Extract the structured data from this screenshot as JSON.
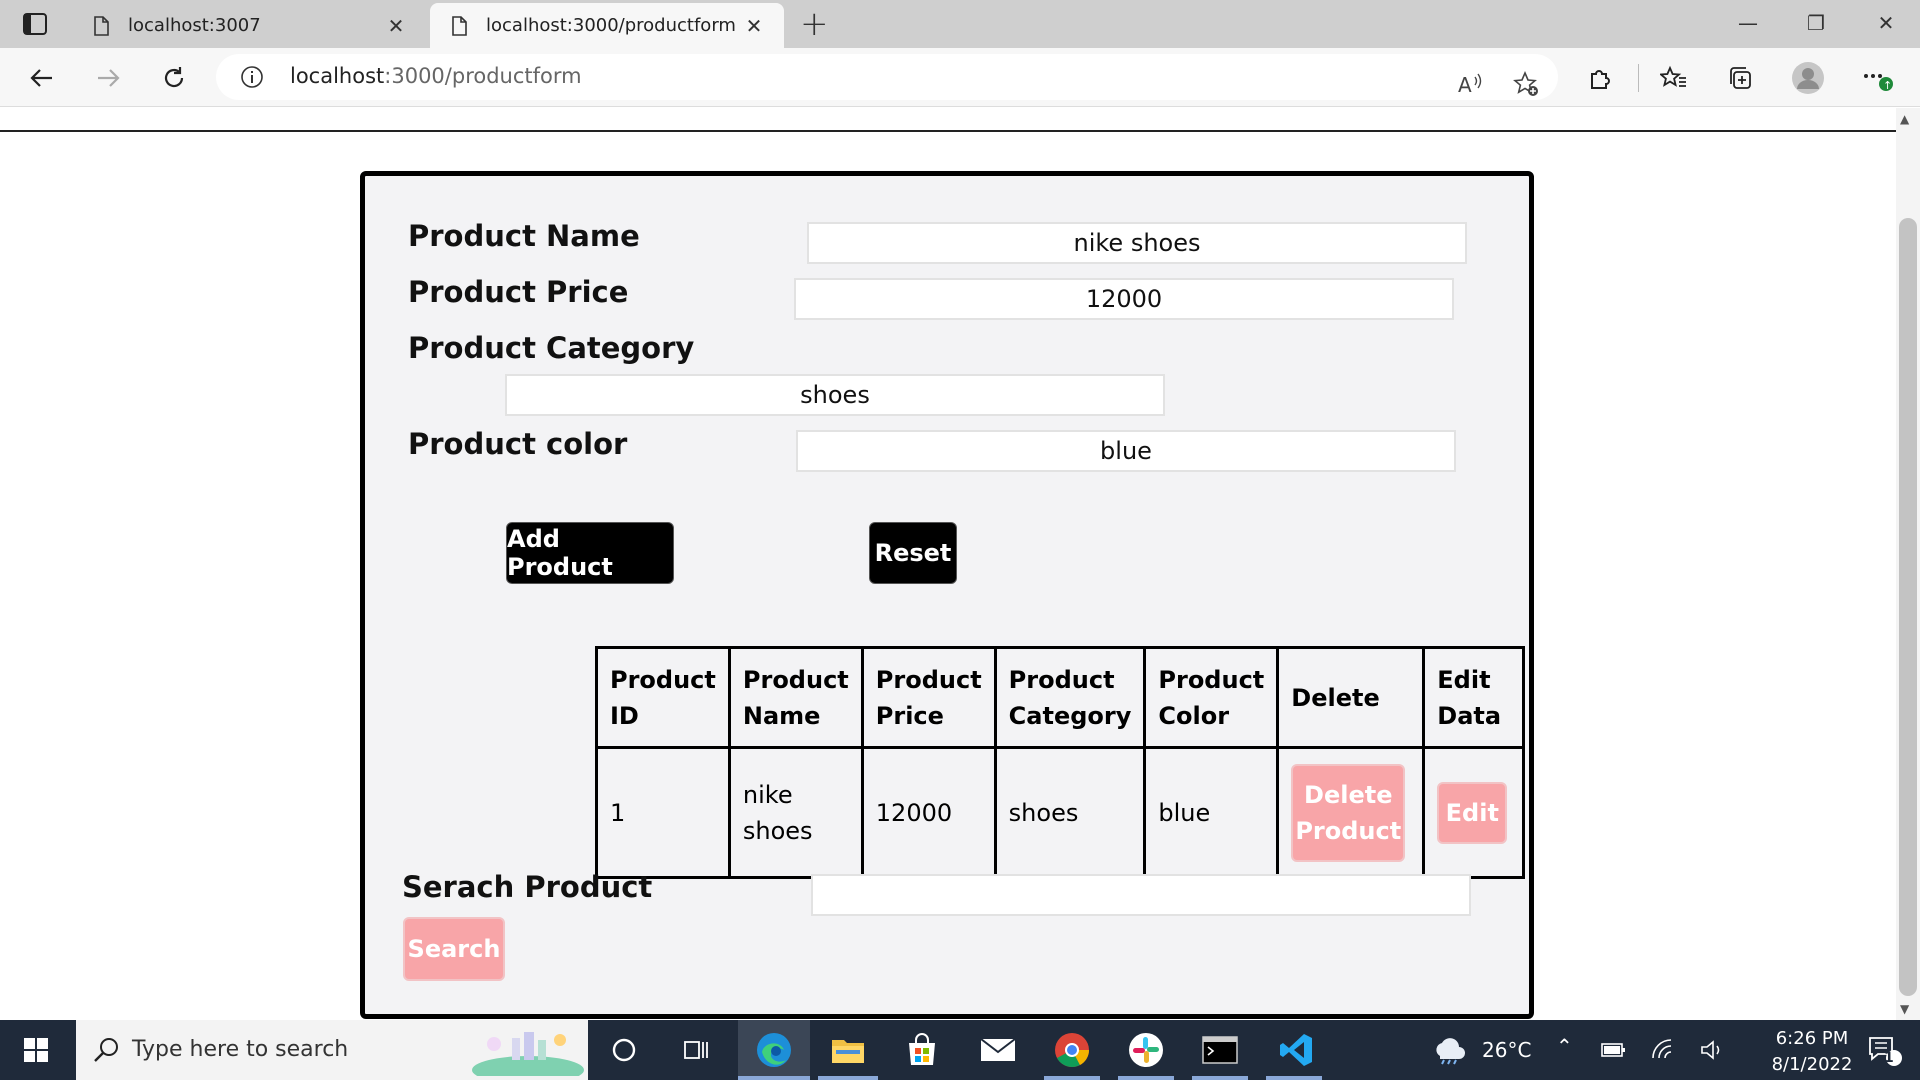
{
  "browser": {
    "tabs": [
      {
        "label": "localhost:3007",
        "close": "✕",
        "active": false
      },
      {
        "label": "localhost:3000/productform",
        "close": "✕",
        "active": true
      }
    ],
    "new_tab": "+",
    "window_controls": {
      "minimize": "—",
      "maximize": "❐",
      "close": "✕"
    },
    "address": {
      "host": "localhost",
      "path": ":3000/productform"
    },
    "icons": [
      "back-icon",
      "forward-icon",
      "refresh-icon",
      "info-icon",
      "read-aloud-icon",
      "add-favorite-icon",
      "extensions-icon",
      "favorites-icon",
      "collections-icon",
      "profile-icon",
      "more-icon"
    ]
  },
  "form": {
    "product_name": {
      "label": "Product Name",
      "value": "nike shoes"
    },
    "product_price": {
      "label": "Product Price",
      "value": "12000"
    },
    "product_category": {
      "label": "Product Category",
      "value": "shoes"
    },
    "product_color": {
      "label": "Product color",
      "value": "blue"
    },
    "add_button": "Add Product",
    "reset_button": "Reset"
  },
  "table": {
    "headers": [
      "Product ID",
      "Product Name",
      "Product Price",
      "Product Category",
      "Product Color",
      "Delete",
      "Edit Data"
    ],
    "rows": [
      {
        "id": "1",
        "name": "nike shoes",
        "price": "12000",
        "category": "shoes",
        "color": "blue",
        "delete_label": "Delete Product",
        "edit_label": "Edit"
      }
    ]
  },
  "search": {
    "label": "Serach Product",
    "value": "",
    "button": "Search"
  },
  "taskbar": {
    "search_placeholder": "Type here to search",
    "weather": "26°C",
    "time": "6:26 PM",
    "date": "8/1/2022",
    "notifications": "1",
    "apps": [
      "cortana-icon",
      "task-view-icon",
      "edge-icon",
      "file-explorer-icon",
      "store-icon",
      "mail-icon",
      "chrome-icon",
      "slack-icon",
      "terminal-icon",
      "vscode-icon"
    ]
  },
  "colors": {
    "panel_bg": "#f3f3f5",
    "pink_button": "#f8a5a8",
    "dark_button": "#000000",
    "taskbar": "#1f2a3a"
  }
}
